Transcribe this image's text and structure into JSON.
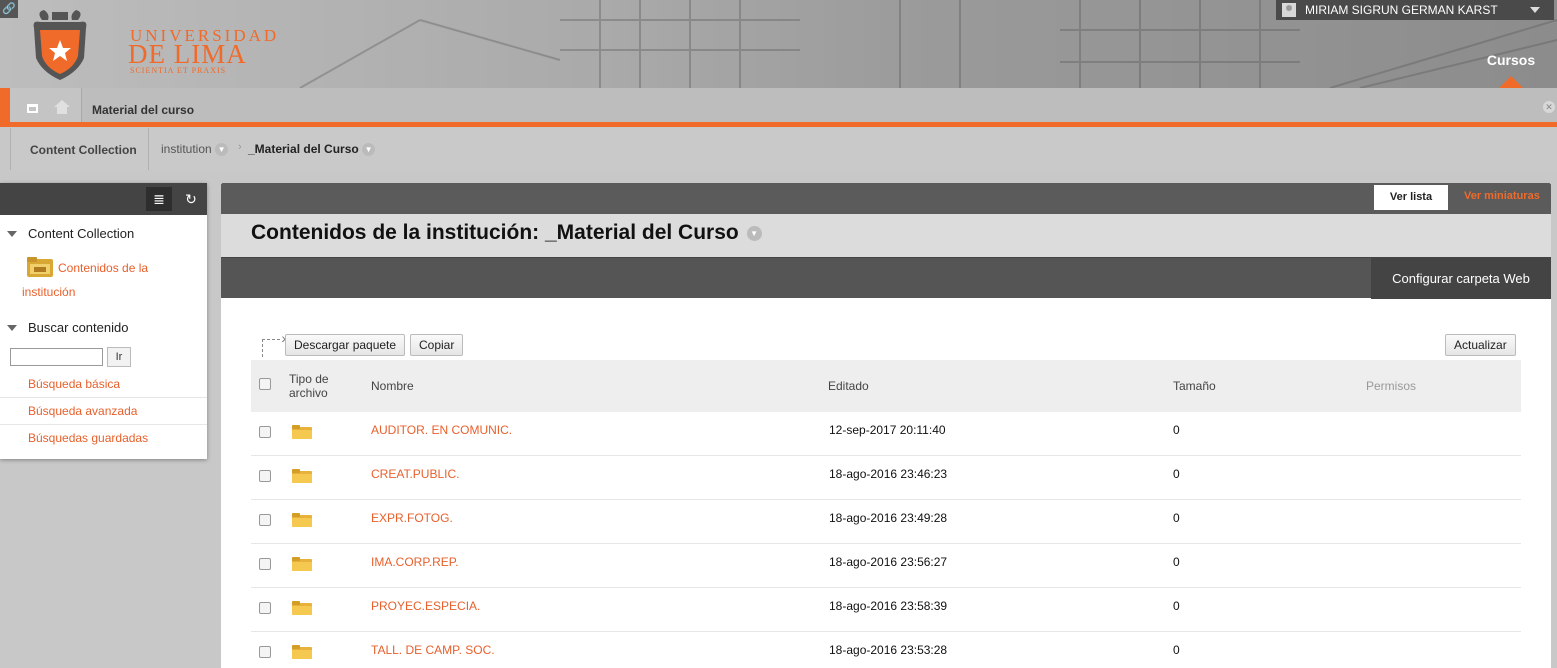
{
  "header": {
    "logo": {
      "line1": "UNIVERSIDAD",
      "line2": "DE LIMA",
      "tagline": "SCIENTIA ET PRAXIS"
    },
    "user_name": "MIRIAM SIGRUN GERMAN KARST",
    "nav_tab": "Cursos"
  },
  "breadcrumb": {
    "title": "Material del curso"
  },
  "path": {
    "root": "Content Collection",
    "items": [
      "institution",
      "_Material del Curso"
    ]
  },
  "sidebar": {
    "section1": {
      "title": "Content Collection",
      "link": "Contenidos de la institución"
    },
    "section2": {
      "title": "Buscar contenido",
      "go_label": "Ir",
      "links": [
        "Búsqueda básica",
        "Búsqueda avanzada",
        "Búsquedas guardadas"
      ]
    }
  },
  "main": {
    "view_list": "Ver lista",
    "view_thumbs": "Ver miniaturas",
    "title": "Contenidos de la institución: _Material del Curso",
    "config_button": "Configurar carpeta Web",
    "download_button": "Descargar paquete",
    "copy_button": "Copiar",
    "refresh_button": "Actualizar",
    "columns": {
      "type_line1": "Tipo de",
      "type_line2": "archivo",
      "name": "Nombre",
      "edited": "Editado",
      "size": "Tamaño",
      "permissions": "Permisos"
    },
    "rows": [
      {
        "name": "AUDITOR. EN COMUNIC.",
        "edited": "12-sep-2017 20:11:40",
        "size": "0"
      },
      {
        "name": "CREAT.PUBLIC.",
        "edited": "18-ago-2016 23:46:23",
        "size": "0"
      },
      {
        "name": "EXPR.FOTOG.",
        "edited": "18-ago-2016 23:49:28",
        "size": "0"
      },
      {
        "name": "IMA.CORP.REP.",
        "edited": "18-ago-2016 23:56:27",
        "size": "0"
      },
      {
        "name": "PROYEC.ESPECIA.",
        "edited": "18-ago-2016 23:58:39",
        "size": "0"
      },
      {
        "name": "TALL. DE CAMP. SOC.",
        "edited": "18-ago-2016 23:53:28",
        "size": "0"
      }
    ]
  },
  "colors": {
    "accent": "#f06a2a",
    "link": "#e8602c"
  }
}
